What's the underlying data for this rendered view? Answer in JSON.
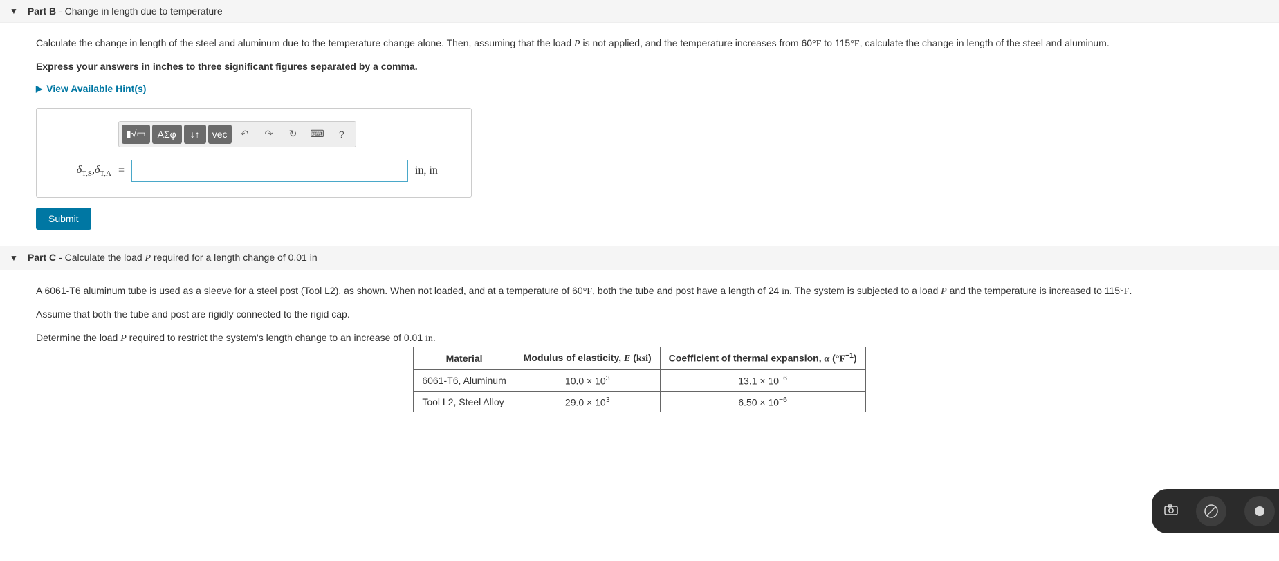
{
  "partB": {
    "label": "Part B",
    "title": "Change in length due to temperature",
    "instructions_html": "Calculate the change in length of the steel and aluminum due to the temperature change alone. Then, assuming that the load <span class='math-i'>P</span> is not applied, and the temperature increases from 60<span class='math-r'>°F</span> to 115<span class='math-r'>°F</span>, calculate the change in length of the steel and aluminum.",
    "express": "Express your answers in inches to three significant figures separated by a comma.",
    "hints_label": "View Available Hint(s)",
    "toolbar": {
      "templates": "▮√▭",
      "greek": "ΑΣφ",
      "sort": "↓↑",
      "vec": "vec",
      "undo": "↶",
      "redo": "↷",
      "reset": "↻",
      "keyboard": "⌨",
      "help": "?"
    },
    "var_label_html": "<span class='math-i'>δ</span><sub>T,S</sub>,<span class='math-i'>δ</span><sub>T,A</sub>",
    "equals": "=",
    "units_html": "<span class='math-r'>in</span>, <span class='math-r'>in</span>",
    "submit": "Submit"
  },
  "partC": {
    "label": "Part C",
    "title_html": "Calculate the load <span class='math-i' style='font-style:italic'>P</span> required for a length change of 0.01 in",
    "p1_html": "A 6061-T6 aluminum tube is used as a sleeve for a steel post (Tool L2), as shown. When not loaded, and at a temperature of 60<span class='math-r'>°F</span>, both the tube and post have a length of 24 <span class='math-r'>in</span>. The system is subjected to a load <span class='math-i'>P</span> and the temperature is increased to 115<span class='math-r'>°F</span>.",
    "p2": "Assume that both the tube and post are rigidly connected to the rigid cap.",
    "p3_html": "Determine the load <span class='math-i'>P</span> required to restrict the system's length change to an increase of 0.01 <span class='math-r'>in</span>.",
    "table": {
      "headers": {
        "material": "Material",
        "modulus_html": "Modulus of elasticity, <span class='math-i'>E</span> (<span class='math-r'>ksi</span>)",
        "alpha_html": "Coefficient of thermal expansion, <span class='math-i'>α</span> (<span class='math-r'>°F</span><sup>−1</sup>)"
      },
      "rows": [
        {
          "material": "6061-T6, Aluminum",
          "E_html": "10.0 × 10<sup>3</sup>",
          "alpha_html": "13.1 × 10<sup>−6</sup>"
        },
        {
          "material": "Tool L2, Steel Alloy",
          "E_html": "29.0 × 10<sup>3</sup>",
          "alpha_html": "6.50 × 10<sup>−6</sup>"
        }
      ]
    }
  },
  "bottom_bar": {
    "camera": "camera-icon",
    "slash": "no-audio-icon",
    "record": "record-icon"
  },
  "chart_data": {
    "type": "table",
    "title": "Material properties",
    "columns": [
      "Material",
      "Modulus of elasticity E (ksi)",
      "Coefficient of thermal expansion α (°F⁻¹)"
    ],
    "rows": [
      [
        "6061-T6, Aluminum",
        10000.0,
        1.31e-05
      ],
      [
        "Tool L2, Steel Alloy",
        29000.0,
        6.5e-06
      ]
    ]
  }
}
